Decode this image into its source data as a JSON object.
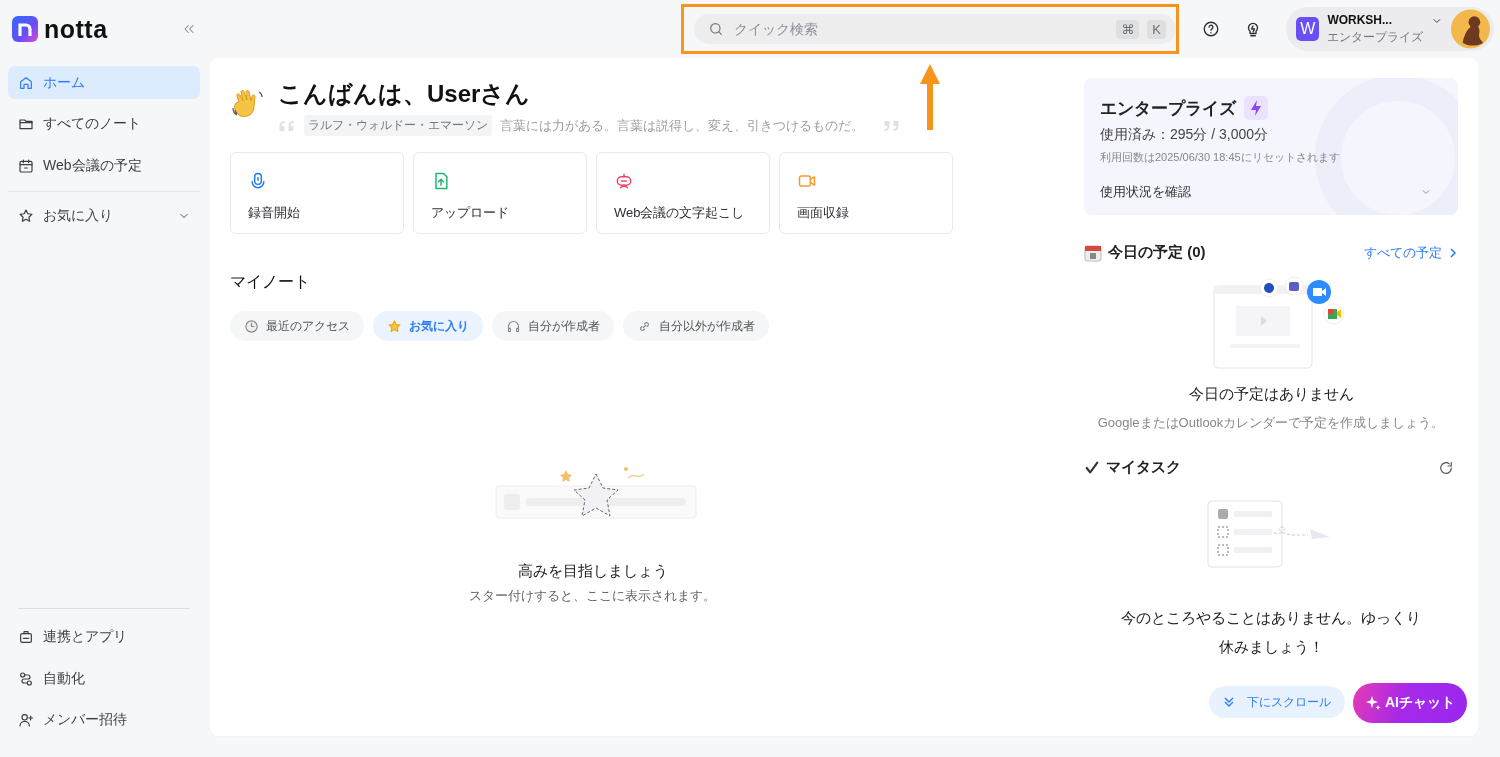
{
  "sidebar": {
    "logo": "notta",
    "items": [
      {
        "label": "ホーム",
        "kind": "home",
        "selected": true
      },
      {
        "label": "すべてのノート",
        "kind": "folder",
        "selected": false
      },
      {
        "label": "Web会議の予定",
        "kind": "calendar",
        "selected": false
      }
    ],
    "favorites": {
      "label": "お気に入り",
      "expanded": false
    },
    "bottom_items": [
      {
        "label": "連携とアプリ",
        "kind": "bag",
        "selected": false
      },
      {
        "label": "自動化",
        "kind": "flow",
        "selected": false
      },
      {
        "label": "メンバー招待",
        "kind": "user-plus",
        "selected": false
      }
    ]
  },
  "search": {
    "placeholder": "クイック検索",
    "keys": [
      "⌘",
      "K"
    ]
  },
  "account": {
    "initial": "W",
    "name": "WORKSH...",
    "plan": "エンタープライズ"
  },
  "greeting": {
    "title": "こんばんは、Userさん",
    "quote_author": "ラルフ・ウォルドー・エマーソン",
    "quote": "言葉には力がある。言葉は説得し、変え、引きつけるものだ。"
  },
  "actions": [
    {
      "label": "録音開始",
      "kind": "mic"
    },
    {
      "label": "アップロード",
      "kind": "upload"
    },
    {
      "label": "Web会議の文字起こし",
      "kind": "meeting"
    },
    {
      "label": "画面収録",
      "kind": "screen"
    }
  ],
  "my_notes": {
    "title": "マイノート",
    "filters": [
      {
        "label": "最近のアクセス",
        "kind": "clock",
        "selected": false
      },
      {
        "label": "お気に入り",
        "kind": "star",
        "selected": true
      },
      {
        "label": "自分が作成者",
        "kind": "headphones",
        "selected": false
      },
      {
        "label": "自分以外が作成者",
        "kind": "link",
        "selected": false
      }
    ],
    "empty_title": "高みを目指しましょう",
    "empty_text": "スター付けすると、ここに表示されます。"
  },
  "plan_card": {
    "title": "エンタープライズ",
    "usage": "使用済み：295分 / 3,000分",
    "reset_note": "利用回数は2025/06/30 18:45にリセットされます",
    "details_label": "使用状況を確認",
    "expanded": false
  },
  "schedule": {
    "title": "今日の予定 (0)",
    "link": "すべての予定",
    "empty_title": "今日の予定はありません",
    "empty_text": "GoogleまたはOutlookカレンダーで予定を作成しましょう。"
  },
  "tasks": {
    "title": "マイタスク",
    "empty_title": "今のところやることはありません。ゆっくり休みましょう！"
  },
  "scroll_hint": "下にスクロール",
  "ai_chat": "AIチャット",
  "annotation": {
    "kind": "highlight-arrow"
  }
}
